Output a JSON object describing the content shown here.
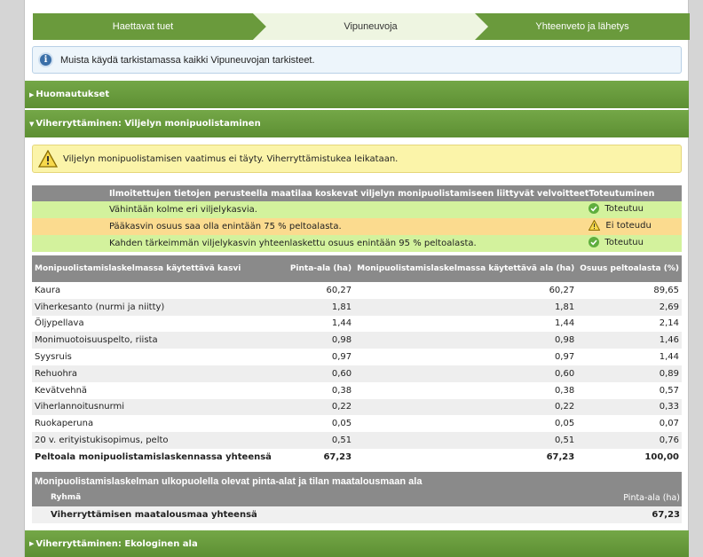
{
  "steps": [
    {
      "label": "Haettavat tuet"
    },
    {
      "label": "Vipuneuvoja"
    },
    {
      "label": "Yhteenveto ja lähetys"
    }
  ],
  "info_message": "Muista käydä tarkistamassa kaikki Vipuneuvojan tarkisteet.",
  "accordions": {
    "notes": "Huomautukset",
    "diversification": "Viherryttäminen: Viljelyn monipuolistaminen",
    "ecological": "Viherryttäminen: Ekologinen ala"
  },
  "warning_message": "Viljelyn monipuolistamisen vaatimus ei täyty. Viherryttämistukea leikataan.",
  "obligations": {
    "headers": {
      "requirement": "Ilmoitettujen tietojen perusteella maatilaa koskevat viljelyn monipuolistamiseen liittyvät velvoitteet",
      "fulfillment": "Toteutuminen"
    },
    "rows": [
      {
        "text": "Vähintään kolme eri viljelykasvia.",
        "status": "Toteutuu",
        "state": "ok"
      },
      {
        "text": "Pääkasvin osuus saa olla enintään 75 % peltoalasta.",
        "status": "Ei toteudu",
        "state": "bad"
      },
      {
        "text": "Kahden tärkeimmän viljelykasvin yhteenlaskettu osuus enintään 95 % peltoalasta.",
        "status": "Toteutuu",
        "state": "ok"
      }
    ]
  },
  "crops": {
    "headers": {
      "crop": "Monipuolistamislaskelmassa käytettävä kasvi",
      "area": "Pinta-ala (ha)",
      "used_area": "Monipuolistamislaskelmassa käytettävä ala (ha)",
      "share": "Osuus peltoalasta (%)"
    },
    "rows": [
      {
        "name": "Kaura",
        "area": "60,27",
        "used": "60,27",
        "share": "89,65"
      },
      {
        "name": "Viherkesanto (nurmi ja niitty)",
        "area": "1,81",
        "used": "1,81",
        "share": "2,69"
      },
      {
        "name": "Öljypellava",
        "area": "1,44",
        "used": "1,44",
        "share": "2,14"
      },
      {
        "name": "Monimuotoisuuspelto, riista",
        "area": "0,98",
        "used": "0,98",
        "share": "1,46"
      },
      {
        "name": "Syysruis",
        "area": "0,97",
        "used": "0,97",
        "share": "1,44"
      },
      {
        "name": "Rehuohra",
        "area": "0,60",
        "used": "0,60",
        "share": "0,89"
      },
      {
        "name": "Kevätvehnä",
        "area": "0,38",
        "used": "0,38",
        "share": "0,57"
      },
      {
        "name": "Viherlannoitusnurmi",
        "area": "0,22",
        "used": "0,22",
        "share": "0,33"
      },
      {
        "name": "Ruokaperuna",
        "area": "0,05",
        "used": "0,05",
        "share": "0,07"
      },
      {
        "name": "20 v. erityistukisopimus, pelto",
        "area": "0,51",
        "used": "0,51",
        "share": "0,76"
      }
    ],
    "total": {
      "label": "Peltoala monipuolistamislaskennassa yhteensä",
      "area": "67,23",
      "used": "67,23",
      "share": "100,00"
    }
  },
  "outside": {
    "title": "Monipuolistamislaskelman ulkopuolella olevat pinta-alat ja tilan maatalousmaan ala",
    "group_header": "Ryhmä",
    "area_header": "Pinta-ala (ha)",
    "total_label": "Viherryttämisen maatalousmaa yhteensä",
    "total_value": "67,23"
  },
  "colors": {
    "accent_green": "#6a9a3c",
    "ok_row": "#d3f29d",
    "bad_row": "#fbdb8f",
    "warning_bg": "#fbf4a9"
  }
}
